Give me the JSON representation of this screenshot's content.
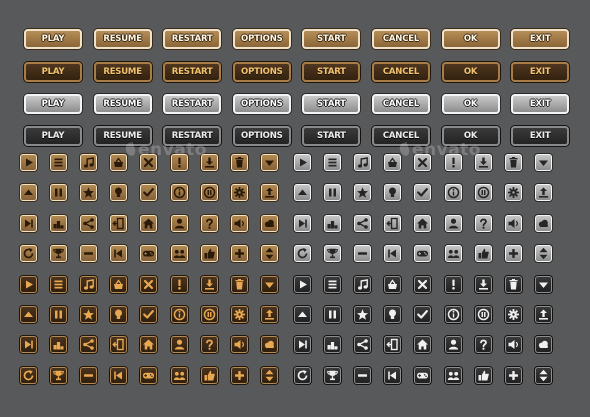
{
  "word_buttons": {
    "labels": [
      "PLAY",
      "RESUME",
      "RESTART",
      "OPTIONS",
      "START",
      "CANCEL",
      "OK",
      "EXIT"
    ],
    "styles": [
      "brown",
      "dark-brown",
      "silver",
      "black"
    ]
  },
  "icon_buttons": {
    "icons": [
      [
        "play-icon",
        "menu-icon",
        "music-icon",
        "shop-basket-icon",
        "close-icon",
        "exclamation-icon",
        "download-icon",
        "trash-icon",
        "arrow-down-icon"
      ],
      [
        "arrow-up-icon",
        "pause-icon",
        "star-icon",
        "lightbulb-icon",
        "check-icon",
        "info-icon",
        "pause-circle-icon",
        "gear-icon",
        "upload-icon"
      ],
      [
        "next-icon",
        "podium-icon",
        "share-icon",
        "exit-door-icon",
        "home-icon",
        "profile-icon",
        "question-icon",
        "sound-icon",
        "cloud-icon"
      ],
      [
        "restart-icon",
        "trophy-icon",
        "minus-icon",
        "back-icon",
        "gamepad-icon",
        "group-icon",
        "thumbs-up-icon",
        "plus-icon",
        "arrows-updown-icon"
      ]
    ],
    "styles": [
      "brown",
      "dark-brown",
      "silver",
      "black"
    ]
  },
  "watermark": {
    "text": "envato",
    "colors": {
      "brown_fill": "#9c7545",
      "brown_rim": "#efe3cd",
      "silver_fill": "#aaaaaa",
      "black_fill": "#2b2b2b",
      "background": "#58595b"
    }
  }
}
